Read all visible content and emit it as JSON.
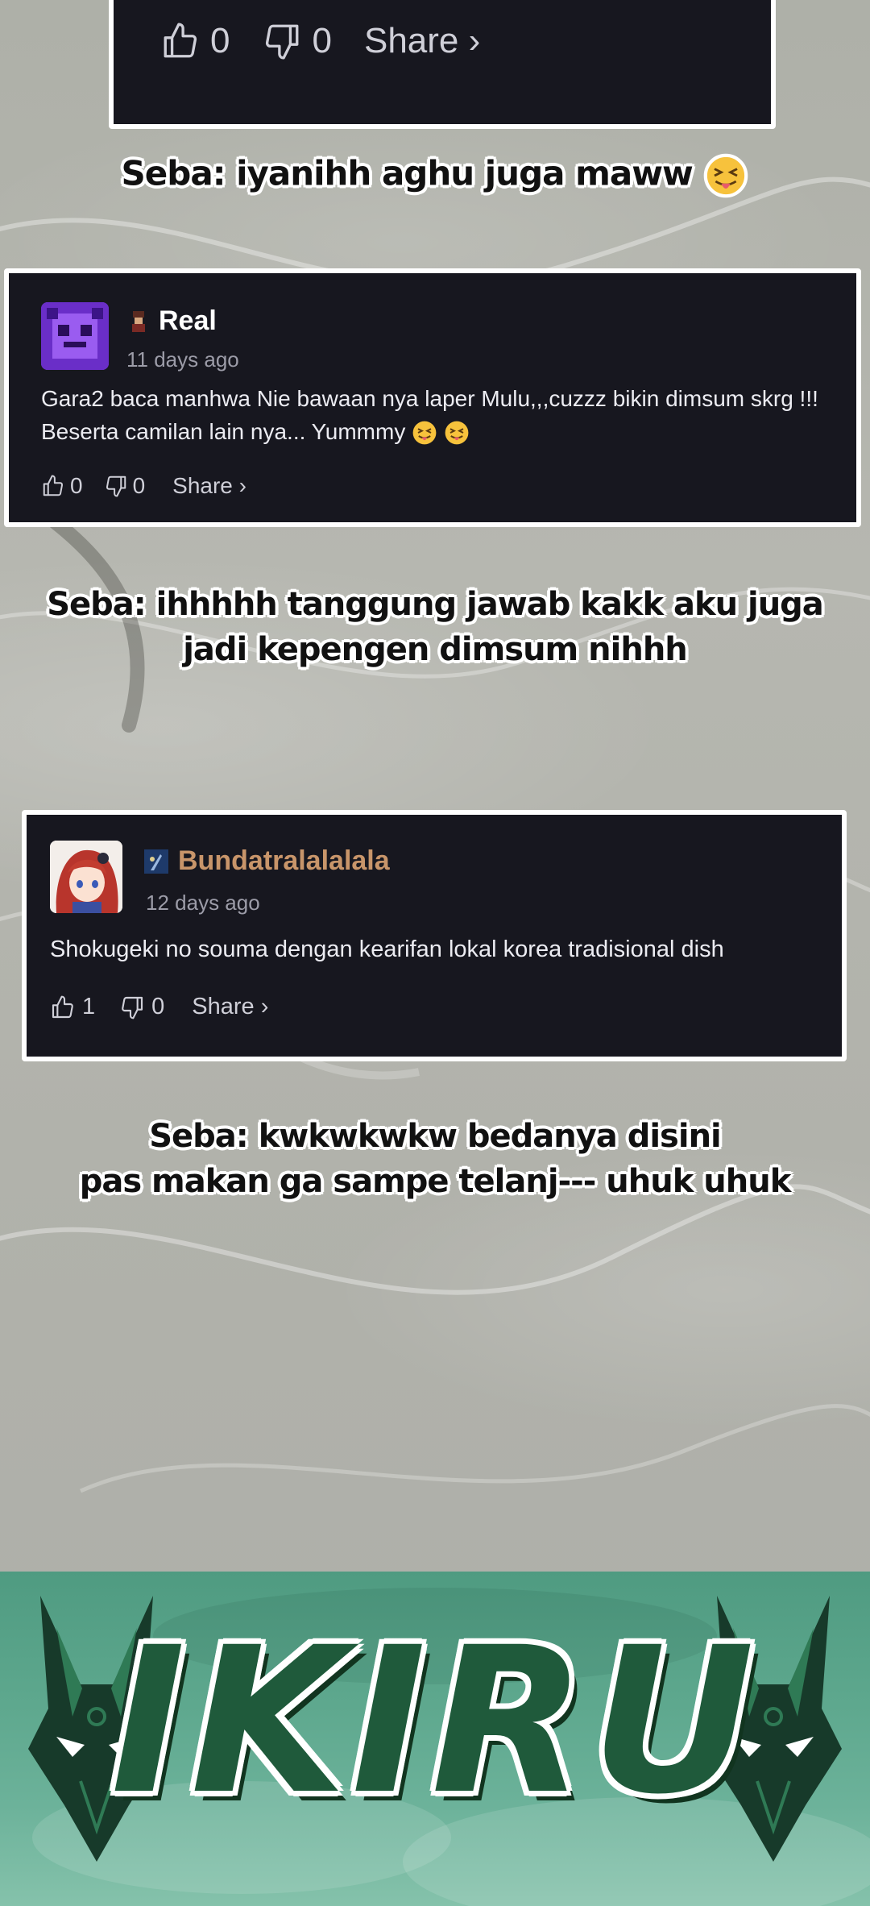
{
  "top_card": {
    "likes": "0",
    "dislikes": "0",
    "share_label": "Share ›"
  },
  "captions": {
    "c1": "Seba: iyanihh aghu juga maww",
    "c2_line1": "Seba: ihhhhh tanggung jawab kakk aku juga",
    "c2_line2": "jadi kepengen dimsum nihhh",
    "c3_line1": "Seba: kwkwkwkw bedanya disini",
    "c3_line2": "pas makan ga sampe telanj--- uhuk uhuk"
  },
  "comment1": {
    "username": "Real",
    "time": "11 days ago",
    "text_line1": "Gara2 baca manhwa Nie bawaan nya laper Mulu,,,cuzzz bikin dimsum skrg !!!",
    "text_line2": "Beserta camilan lain nya... Yummmy",
    "likes": "0",
    "dislikes": "0",
    "share_label": "Share ›"
  },
  "comment2": {
    "username": "Bundatralalalala",
    "time": "12 days ago",
    "text": "Shokugeki no souma dengan kearifan lokal korea tradisional dish",
    "likes": "1",
    "dislikes": "0",
    "share_label": "Share ›"
  },
  "banner": {
    "logo": "IKIRU"
  },
  "colors": {
    "card_bg": "#17171f",
    "username2": "#c8956a",
    "banner_green": "#5ea88e",
    "logo_green": "#1f5a3b"
  }
}
